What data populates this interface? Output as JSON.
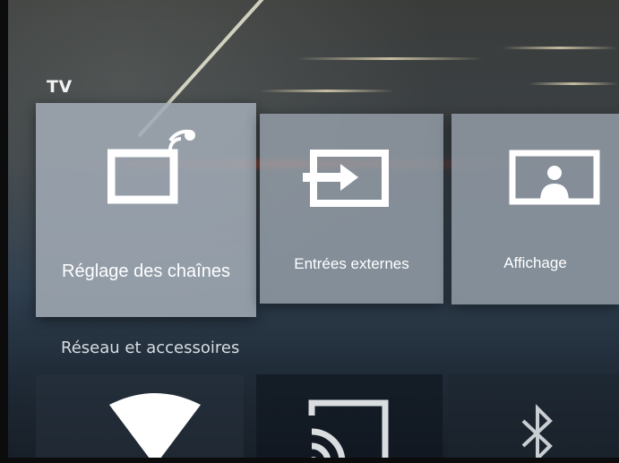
{
  "sections": {
    "tv": {
      "title": "TV"
    },
    "network": {
      "title": "Réseau et accessoires"
    }
  },
  "cards": {
    "channels": {
      "label": "Réglage des chaînes",
      "icon": "tv-antenna-icon"
    },
    "inputs": {
      "label": "Entrées externes",
      "icon": "input-source-icon"
    },
    "display": {
      "label": "Affichage",
      "icon": "display-picture-icon"
    }
  },
  "tiles": {
    "wifi": {
      "icon": "wifi-icon"
    },
    "cast": {
      "icon": "cast-icon"
    },
    "bluetooth": {
      "icon": "bluetooth-icon"
    }
  },
  "colors": {
    "card_background": "#9aa4ae",
    "text": "#ffffff",
    "screen_background": "#2e3e4e"
  }
}
